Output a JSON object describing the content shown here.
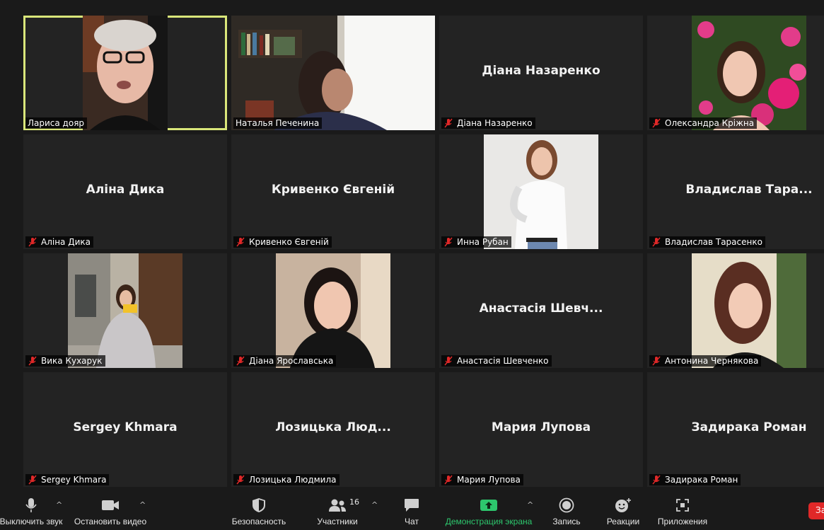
{
  "participants": [
    {
      "display_name": "",
      "label": "Лариса дояр",
      "muted": false,
      "active_speaker": true,
      "video": "lady-glasses"
    },
    {
      "display_name": "",
      "label": "Наталья Печенина",
      "muted": false,
      "video": "room-window"
    },
    {
      "display_name": "Діана Назаренко",
      "label": "Діана Назаренко",
      "muted": true
    },
    {
      "display_name": "",
      "label": "Олександра Кріжна",
      "muted": true,
      "video": "girl-flowers"
    },
    {
      "display_name": "Аліна Дика",
      "label": "Аліна Дика",
      "muted": true
    },
    {
      "display_name": "Кривенко Євгеній",
      "label": "Кривенко Євгеній",
      "muted": true
    },
    {
      "display_name": "",
      "label": "Инна Рубан",
      "muted": true,
      "video": "girl-white-shirt"
    },
    {
      "display_name": "Владислав  Тара...",
      "label": "Владислав Тарасенко",
      "muted": true
    },
    {
      "display_name": "",
      "label": "Вика Кухарук",
      "muted": true,
      "video": "girl-street"
    },
    {
      "display_name": "",
      "label": "Діана Ярославська",
      "muted": true,
      "video": "girl-black-hoodie"
    },
    {
      "display_name": "Анастасія  Шевч...",
      "label": "Анастасія Шевченко",
      "muted": true
    },
    {
      "display_name": "",
      "label": "Антонина Чернякова",
      "muted": true,
      "video": "girl-sunlit"
    },
    {
      "display_name": "Sergey Khmara",
      "label": "Sergey Khmara",
      "muted": true
    },
    {
      "display_name": "Лозицька  Люд...",
      "label": "Лозицька Людмила",
      "muted": true
    },
    {
      "display_name": "Мария Лупова",
      "label": "Мария Лупова",
      "muted": true
    },
    {
      "display_name": "Задирака Роман",
      "label": "Задирака Роман",
      "muted": true
    }
  ],
  "toolbar": {
    "mute_label": "Выключить звук",
    "video_label": "Остановить видео",
    "security_label": "Безопасность",
    "participants_label": "Участники",
    "participants_count": "16",
    "chat_label": "Чат",
    "share_label": "Демонстрация экрана",
    "record_label": "Запись",
    "reactions_label": "Реакции",
    "apps_label": "Приложения",
    "end_label": "За"
  },
  "colors": {
    "share_green": "#2dc76d",
    "active_outline": "#d9e67a",
    "muted_red": "#e02828",
    "end_red": "#e02828"
  }
}
